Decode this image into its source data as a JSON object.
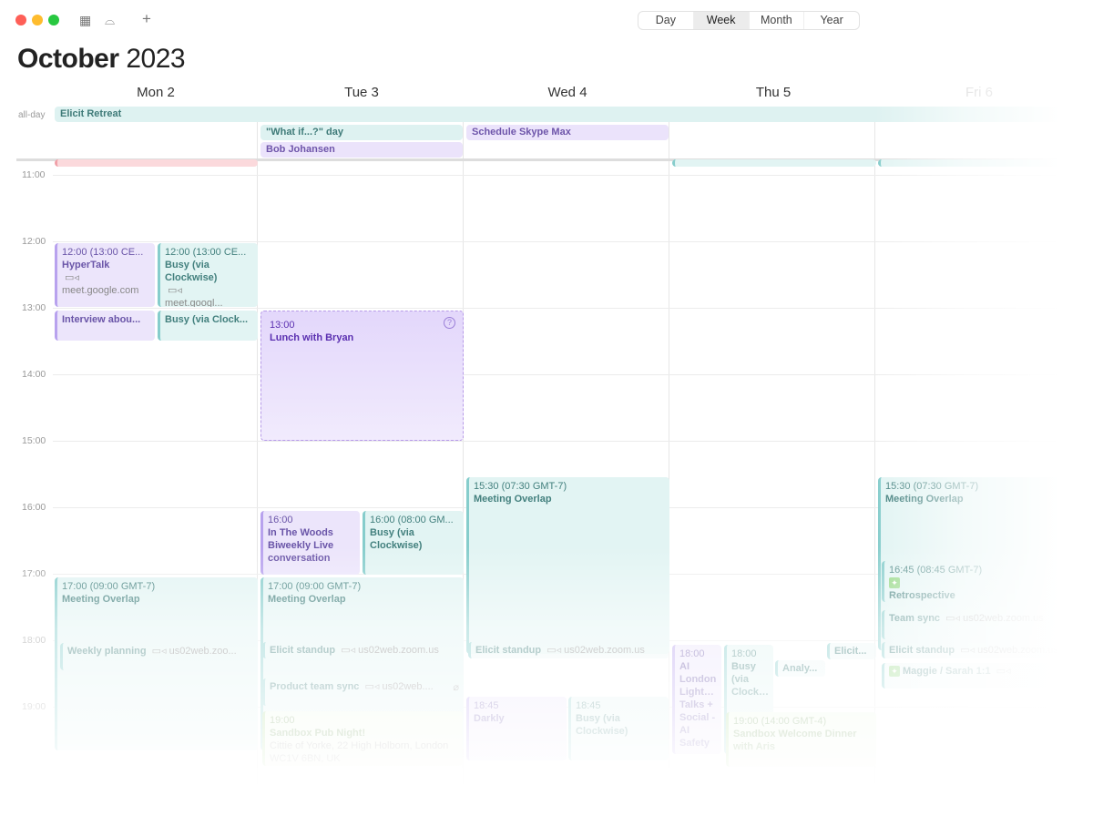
{
  "toolbar": {
    "icons": [
      "calendar-icon",
      "inbox-icon",
      "plus-icon"
    ],
    "views": [
      "Day",
      "Week",
      "Month",
      "Year"
    ],
    "selected_view": "Week"
  },
  "header": {
    "month": "October",
    "year": "2023"
  },
  "days": [
    "Mon 2",
    "Tue 3",
    "Wed 4",
    "Thu 5",
    "Fri 6"
  ],
  "allday": {
    "label": "all-day",
    "events": [
      {
        "title": "Elicit Retreat",
        "color": "teal"
      },
      {
        "title": "\"What if...?\" day",
        "color": "teal"
      },
      {
        "title": "Bob Johansen",
        "color": "purple"
      },
      {
        "title": "Schedule Skype Max",
        "color": "purple"
      }
    ]
  },
  "hours": [
    "11:00",
    "12:00",
    "13:00",
    "14:00",
    "15:00",
    "16:00",
    "17:00",
    "18:00",
    "19:00"
  ],
  "colors": {
    "purple": "#ece5fb",
    "teal": "#e2f4f3",
    "green": "#eef8e8",
    "red": "#fbd9dc"
  },
  "events": [
    {
      "day": "Mon 2",
      "color": "red",
      "lines": []
    },
    {
      "day": "Mon 2",
      "color": "purple",
      "start": "12:00",
      "time": "12:00 (13:00 CE...",
      "title": "HyperTalk",
      "video": true,
      "location": "meet.google.com"
    },
    {
      "day": "Mon 2",
      "color": "teal",
      "start": "12:00",
      "time": "12:00 (13:00 CE...",
      "title": "Busy (via Clockwise)",
      "video": true,
      "location": "meet.googl..."
    },
    {
      "day": "Mon 2",
      "color": "purple",
      "start": "13:00",
      "title": "Interview abou..."
    },
    {
      "day": "Mon 2",
      "color": "teal",
      "start": "13:00",
      "title": "Busy (via Clock..."
    },
    {
      "day": "Mon 2",
      "color": "teal",
      "start": "17:00",
      "time": "17:00 (09:00 GMT-7)",
      "title": "Meeting Overlap"
    },
    {
      "day": "Mon 2",
      "color": "teal",
      "start": "18:00",
      "title": "Weekly planning",
      "video": true,
      "location": "us02web.zoo..."
    },
    {
      "day": "Tue 3",
      "color": "lunch",
      "start": "13:00",
      "time": "13:00",
      "title": "Lunch with Bryan",
      "icon": "question-icon"
    },
    {
      "day": "Tue 3",
      "color": "purple",
      "start": "16:00",
      "time": "16:00",
      "title": "In The Woods Biweekly Live conversation"
    },
    {
      "day": "Tue 3",
      "color": "teal",
      "start": "16:00",
      "time": "16:00 (08:00 GM...",
      "title": "Busy (via Clockwise)"
    },
    {
      "day": "Tue 3",
      "color": "teal",
      "start": "17:00",
      "time": "17:00 (09:00 GMT-7)",
      "title": "Meeting Overlap"
    },
    {
      "day": "Tue 3",
      "color": "teal",
      "start": "18:00",
      "title": "Elicit standup",
      "video": true,
      "location": "us02web.zoom.us"
    },
    {
      "day": "Tue 3",
      "color": "teal",
      "start": "18:30",
      "title": "Product team sync",
      "video": true,
      "location": "us02web....",
      "icon": "paperclip-icon"
    },
    {
      "day": "Tue 3",
      "color": "green",
      "start": "19:00",
      "time": "19:00",
      "title": "Sandbox Pub Night!",
      "location": "Cittie of Yorke, 22 High Holborn, London WC1V 6BN, UK"
    },
    {
      "day": "Wed 4",
      "color": "teal",
      "start": "15:30",
      "time": "15:30 (07:30 GMT-7)",
      "title": "Meeting Overlap"
    },
    {
      "day": "Wed 4",
      "color": "teal",
      "start": "18:00",
      "title": "Elicit standup",
      "video": true,
      "location": "us02web.zoom.us"
    },
    {
      "day": "Wed 4",
      "color": "purple",
      "start": "18:45",
      "time": "18:45",
      "title": "Darkly"
    },
    {
      "day": "Wed 4",
      "color": "teal",
      "start": "18:45",
      "time": "18:45",
      "title": "Busy (via Clockwise)"
    },
    {
      "day": "Thu 5",
      "color": "teal",
      "lines": []
    },
    {
      "day": "Thu 5",
      "color": "purple",
      "start": "18:00",
      "time": "18:00",
      "title": "AI London Lightning Talks + Social - AI Safety"
    },
    {
      "day": "Thu 5",
      "color": "teal",
      "start": "18:00",
      "time": "18:00",
      "title": "Busy (via Clockwise)"
    },
    {
      "day": "Thu 5",
      "color": "teal",
      "title": "Analy..."
    },
    {
      "day": "Thu 5",
      "color": "teal",
      "title": "Elicit..."
    },
    {
      "day": "Thu 5",
      "color": "green",
      "start": "19:00",
      "time": "19:00 (14:00 GMT-4)",
      "title": "Sandbox Welcome Dinner with Aris"
    },
    {
      "day": "Fri 6",
      "color": "teal",
      "lines": []
    },
    {
      "day": "Fri 6",
      "color": "teal",
      "start": "15:30",
      "time": "15:30 (07:30 GMT-7)",
      "title": "Meeting Overlap"
    },
    {
      "day": "Fri 6",
      "color": "teal",
      "start": "16:45",
      "time": "16:45 (08:45 GMT-7)",
      "title": "Retrospective",
      "icon": "sparkle-icon",
      "video": true,
      "location": "us02web..."
    },
    {
      "day": "Fri 6",
      "color": "teal",
      "title": "Team sync",
      "video": true,
      "location": "us02web.zoom.us"
    },
    {
      "day": "Fri 6",
      "color": "teal",
      "title": "Elicit standup",
      "video": true,
      "location": "us02web.zoom.us"
    },
    {
      "day": "Fri 6",
      "color": "teal",
      "title": "Maggie / Sarah 1:1",
      "icon": "sparkle-icon",
      "video": true
    }
  ]
}
